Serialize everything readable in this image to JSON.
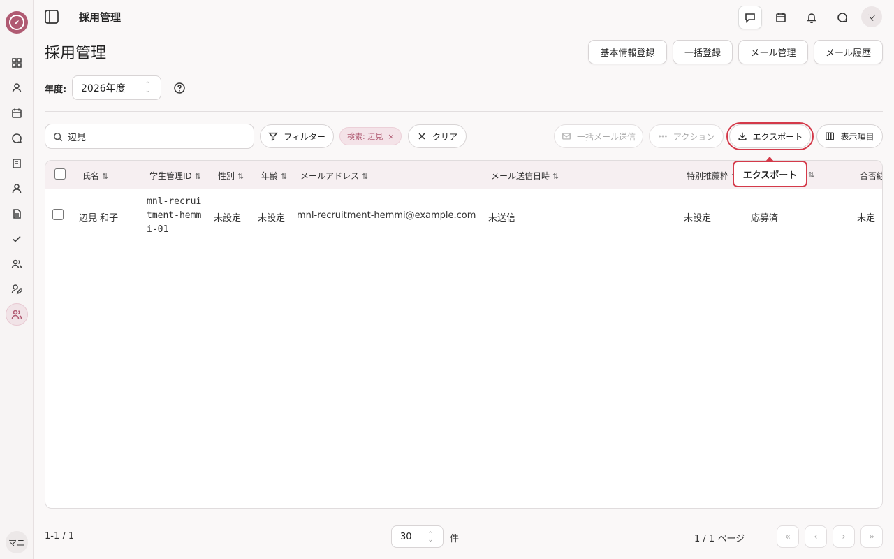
{
  "app": {
    "logo_text": "",
    "user_initials": "マニ"
  },
  "topbar": {
    "title": "採用管理",
    "avatar_initial": "マ"
  },
  "page": {
    "title": "採用管理",
    "buttons": [
      "基本情報登録",
      "一括登録",
      "メール管理",
      "メール履歴"
    ],
    "year_label": "年度:",
    "year_value": "2026年度"
  },
  "toolbar": {
    "search_value": "辺見",
    "filter_label": "フィルター",
    "chip_label": "検索: 辺見",
    "clear_label": "クリア",
    "bulk_mail_label": "一括メール送信",
    "action_label": "アクション",
    "export_label": "エクスポート",
    "columns_label": "表示項目",
    "tooltip": "エクスポート"
  },
  "table": {
    "headers": [
      "氏名",
      "学生管理ID",
      "性別",
      "年齢",
      "メールアドレス",
      "メール送信日時",
      "特別推薦枠",
      "",
      "合否結"
    ],
    "sort_glyph": "⇅",
    "rows": [
      {
        "name": "辺見 和子",
        "student_id": "mnl-recruitment-hemmi-01",
        "gender": "未設定",
        "age": "未設定",
        "email": "mnl-recruitment-hemmi@example.com",
        "mail_sent": "未送信",
        "special": "未設定",
        "status": "応募済",
        "result": "未定"
      }
    ]
  },
  "footer": {
    "count": "1-1 / 1",
    "page_size": "30",
    "unit": "件",
    "page_info": "1 / 1 ページ",
    "first": "«",
    "prev": "‹",
    "next": "›",
    "last": "»"
  },
  "colors": {
    "accent": "#b05a72",
    "highlight": "#d43a4a"
  }
}
